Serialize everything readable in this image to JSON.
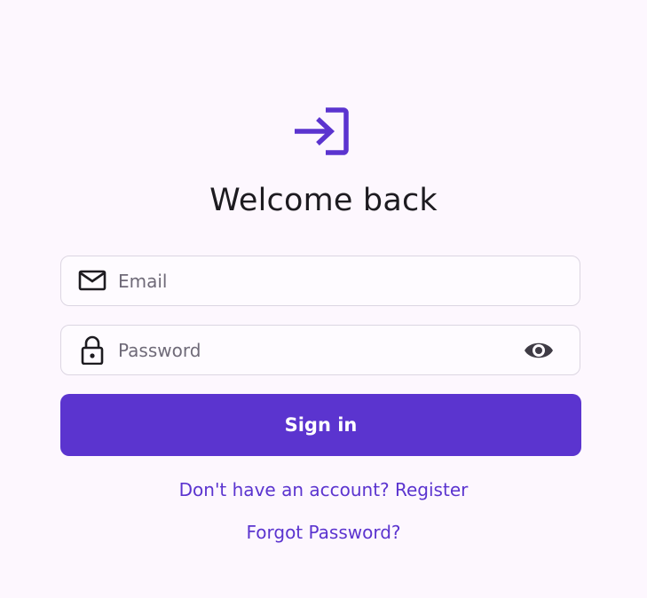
{
  "colors": {
    "background": "#fdf7fe",
    "accent": "#5b34cf",
    "title_text": "#1d1b20",
    "field_border": "#dcd6e2",
    "placeholder": "#6f6a78"
  },
  "header": {
    "icon": "login-icon",
    "title": "Welcome back"
  },
  "form": {
    "email": {
      "icon": "mail-icon",
      "placeholder": "Email",
      "value": ""
    },
    "password": {
      "icon": "lock-icon",
      "placeholder": "Password",
      "value": "",
      "toggle_icon": "eye-icon"
    },
    "submit_label": "Sign in"
  },
  "links": {
    "register": "Don't have an account? Register",
    "forgot_password": "Forgot Password?"
  }
}
